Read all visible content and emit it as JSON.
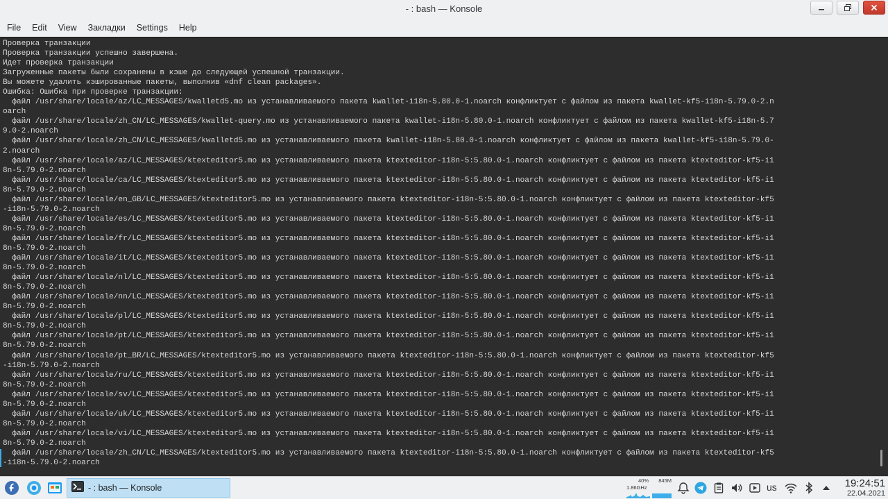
{
  "window": {
    "title": "- : bash — Konsole"
  },
  "menu": {
    "items": [
      "File",
      "Edit",
      "View",
      "Закладки",
      "Settings",
      "Help"
    ]
  },
  "terminal": {
    "lines": [
      "Проверка транзакции",
      "Проверка транзакции успешно завершена.",
      "Идет проверка транзакции",
      "Загруженные пакеты были сохранены в кэше до следующей успешной транзакции.",
      "Вы можете удалить кэшированные пакеты, выполнив «dnf clean packages».",
      "Ошибка: Ошибка при проверке транзакции:",
      "  файл /usr/share/locale/az/LC_MESSAGES/kwalletd5.mo из устанавливаемого пакета kwallet-i18n-5.80.0-1.noarch конфликтует с файлом из пакета kwallet-kf5-i18n-5.79.0-2.n",
      "oarch",
      "  файл /usr/share/locale/zh_CN/LC_MESSAGES/kwallet-query.mo из устанавливаемого пакета kwallet-i18n-5.80.0-1.noarch конфликтует с файлом из пакета kwallet-kf5-i18n-5.7",
      "9.0-2.noarch",
      "  файл /usr/share/locale/zh_CN/LC_MESSAGES/kwalletd5.mo из устанавливаемого пакета kwallet-i18n-5.80.0-1.noarch конфликтует с файлом из пакета kwallet-kf5-i18n-5.79.0-",
      "2.noarch",
      "  файл /usr/share/locale/az/LC_MESSAGES/ktexteditor5.mo из устанавливаемого пакета ktexteditor-i18n-5:5.80.0-1.noarch конфликтует с файлом из пакета ktexteditor-kf5-i1",
      "8n-5.79.0-2.noarch",
      "  файл /usr/share/locale/ca/LC_MESSAGES/ktexteditor5.mo из устанавливаемого пакета ktexteditor-i18n-5:5.80.0-1.noarch конфликтует с файлом из пакета ktexteditor-kf5-i1",
      "8n-5.79.0-2.noarch",
      "  файл /usr/share/locale/en_GB/LC_MESSAGES/ktexteditor5.mo из устанавливаемого пакета ktexteditor-i18n-5:5.80.0-1.noarch конфликтует с файлом из пакета ktexteditor-kf5",
      "-i18n-5.79.0-2.noarch",
      "  файл /usr/share/locale/es/LC_MESSAGES/ktexteditor5.mo из устанавливаемого пакета ktexteditor-i18n-5:5.80.0-1.noarch конфликтует с файлом из пакета ktexteditor-kf5-i1",
      "8n-5.79.0-2.noarch",
      "  файл /usr/share/locale/fr/LC_MESSAGES/ktexteditor5.mo из устанавливаемого пакета ktexteditor-i18n-5:5.80.0-1.noarch конфликтует с файлом из пакета ktexteditor-kf5-i1",
      "8n-5.79.0-2.noarch",
      "  файл /usr/share/locale/it/LC_MESSAGES/ktexteditor5.mo из устанавливаемого пакета ktexteditor-i18n-5:5.80.0-1.noarch конфликтует с файлом из пакета ktexteditor-kf5-i1",
      "8n-5.79.0-2.noarch",
      "  файл /usr/share/locale/nl/LC_MESSAGES/ktexteditor5.mo из устанавливаемого пакета ktexteditor-i18n-5:5.80.0-1.noarch конфликтует с файлом из пакета ktexteditor-kf5-i1",
      "8n-5.79.0-2.noarch",
      "  файл /usr/share/locale/nn/LC_MESSAGES/ktexteditor5.mo из устанавливаемого пакета ktexteditor-i18n-5:5.80.0-1.noarch конфликтует с файлом из пакета ktexteditor-kf5-i1",
      "8n-5.79.0-2.noarch",
      "  файл /usr/share/locale/pl/LC_MESSAGES/ktexteditor5.mo из устанавливаемого пакета ktexteditor-i18n-5:5.80.0-1.noarch конфликтует с файлом из пакета ktexteditor-kf5-i1",
      "8n-5.79.0-2.noarch",
      "  файл /usr/share/locale/pt/LC_MESSAGES/ktexteditor5.mo из устанавливаемого пакета ktexteditor-i18n-5:5.80.0-1.noarch конфликтует с файлом из пакета ktexteditor-kf5-i1",
      "8n-5.79.0-2.noarch",
      "  файл /usr/share/locale/pt_BR/LC_MESSAGES/ktexteditor5.mo из устанавливаемого пакета ktexteditor-i18n-5:5.80.0-1.noarch конфликтует с файлом из пакета ktexteditor-kf5",
      "-i18n-5.79.0-2.noarch",
      "  файл /usr/share/locale/ru/LC_MESSAGES/ktexteditor5.mo из устанавливаемого пакета ktexteditor-i18n-5:5.80.0-1.noarch конфликтует с файлом из пакета ktexteditor-kf5-i1",
      "8n-5.79.0-2.noarch",
      "  файл /usr/share/locale/sv/LC_MESSAGES/ktexteditor5.mo из устанавливаемого пакета ktexteditor-i18n-5:5.80.0-1.noarch конфликтует с файлом из пакета ktexteditor-kf5-i1",
      "8n-5.79.0-2.noarch",
      "  файл /usr/share/locale/uk/LC_MESSAGES/ktexteditor5.mo из устанавливаемого пакета ktexteditor-i18n-5:5.80.0-1.noarch конфликтует с файлом из пакета ktexteditor-kf5-i1",
      "8n-5.79.0-2.noarch",
      "  файл /usr/share/locale/vi/LC_MESSAGES/ktexteditor5.mo из устанавливаемого пакета ktexteditor-i18n-5:5.80.0-1.noarch конфликтует с файлом из пакета ktexteditor-kf5-i1",
      "8n-5.79.0-2.noarch",
      "  файл /usr/share/locale/zh_CN/LC_MESSAGES/ktexteditor5.mo из устанавливаемого пакета ktexteditor-i18n-5:5.80.0-1.noarch конфликтует с файлом из пакета ktexteditor-kf5",
      "-i18n-5.79.0-2.noarch"
    ]
  },
  "taskbar": {
    "task_label": "- : bash — Konsole",
    "cpu_percent": "40%",
    "cpu_freq": "1.86GHz",
    "mem_used": "845M",
    "keyboard_layout": "us",
    "time": "19:24:51",
    "date": "22.04.2021"
  },
  "colors": {
    "terminal_bg": "#2d2d2d",
    "terminal_fg": "#d6d6d6",
    "accent": "#3daee9",
    "panel_bg": "#eff0f1"
  }
}
